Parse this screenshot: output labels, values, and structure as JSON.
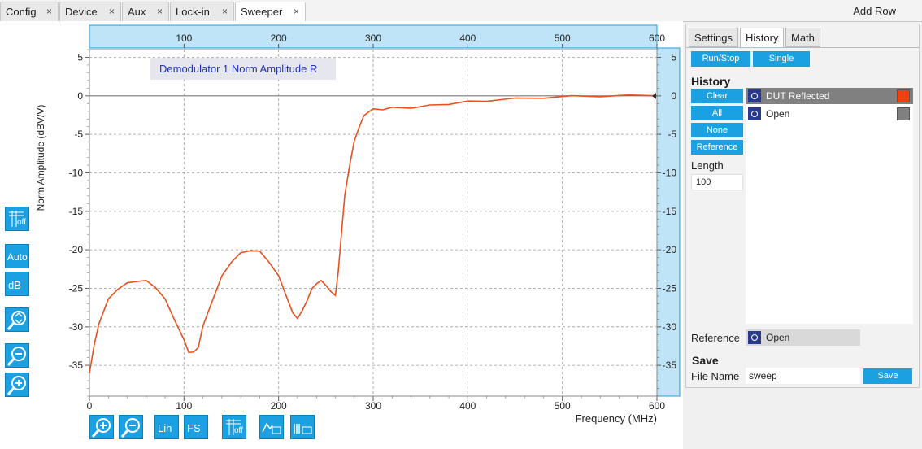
{
  "tabs": [
    {
      "label": "Config"
    },
    {
      "label": "Device"
    },
    {
      "label": "Aux"
    },
    {
      "label": "Lock-in"
    },
    {
      "label": "Sweeper"
    }
  ],
  "tab_close": "×",
  "add_row": "Add Row",
  "plot": {
    "legend": "Demodulator 1 Norm Amplitude R",
    "ylabel": "Norm Amplitude (dBV/V)",
    "xlabel": "Frequency (MHz)",
    "xticks": [
      "0",
      "100",
      "200",
      "300",
      "400",
      "500",
      "600"
    ],
    "topticks": [
      "100",
      "200",
      "300",
      "400",
      "500",
      "600"
    ],
    "yticks": [
      "5",
      "0",
      "-5",
      "-10",
      "-15",
      "-20",
      "-25",
      "-30",
      "-35"
    ]
  },
  "chart_data": {
    "type": "line",
    "xlabel": "Frequency (MHz)",
    "ylabel": "Norm Amplitude (dBV/V)",
    "xlim": [
      0,
      600
    ],
    "ylim": [
      -39,
      6
    ],
    "grid": true,
    "series": [
      {
        "name": "Demodulator 1 Norm Amplitude R",
        "color": "#e8501e",
        "x": [
          0,
          5,
          10,
          20,
          30,
          40,
          50,
          60,
          70,
          80,
          90,
          100,
          105,
          110,
          115,
          120,
          130,
          140,
          150,
          160,
          170,
          180,
          190,
          200,
          210,
          215,
          220,
          225,
          230,
          235,
          240,
          245,
          250,
          255,
          260,
          263,
          267,
          270,
          275,
          280,
          285,
          290,
          295,
          300,
          310,
          320,
          340,
          360,
          380,
          400,
          420,
          450,
          480,
          510,
          540,
          570,
          600
        ],
        "y": [
          -36,
          -32.5,
          -29.5,
          -26.5,
          -25,
          -24.4,
          -24,
          -24.1,
          -24.8,
          -26.5,
          -29,
          -31.8,
          -33.2,
          -33.4,
          -32.6,
          -30,
          -26.5,
          -23.5,
          -21.5,
          -20.5,
          -20,
          -20.3,
          -21.5,
          -23.5,
          -26.5,
          -28.3,
          -28.8,
          -28,
          -26.5,
          -25.2,
          -24.3,
          -24.1,
          -24.5,
          -25.5,
          -25.8,
          -23,
          -17,
          -13,
          -9,
          -6,
          -4,
          -2.7,
          -2,
          -1.8,
          -1.7,
          -1.6,
          -1.5,
          -1.3,
          -1,
          -0.8,
          -0.6,
          -0.4,
          -0.2,
          -0.1,
          0,
          0,
          0
        ]
      }
    ]
  },
  "right_panel": {
    "tabs": [
      "Settings",
      "History",
      "Math"
    ],
    "run_stop": "Run/Stop",
    "single": "Single",
    "history_label": "History",
    "buttons": [
      "Clear",
      "All",
      "None",
      "Reference"
    ],
    "length_label": "Length",
    "length_value": "100",
    "history_items": [
      {
        "label": "DUT Reflected",
        "color": "#f04010"
      },
      {
        "label": "Open",
        "color": "#808080"
      }
    ],
    "reference_label": "Reference",
    "reference_value": "Open",
    "save_label": "Save",
    "file_name_label": "File Name",
    "file_name_value": "sweep",
    "save_button": "Save"
  },
  "tools": {
    "grid_off": "off",
    "auto": "Auto",
    "db": "dB",
    "lin": "Lin",
    "fs": "FS"
  }
}
